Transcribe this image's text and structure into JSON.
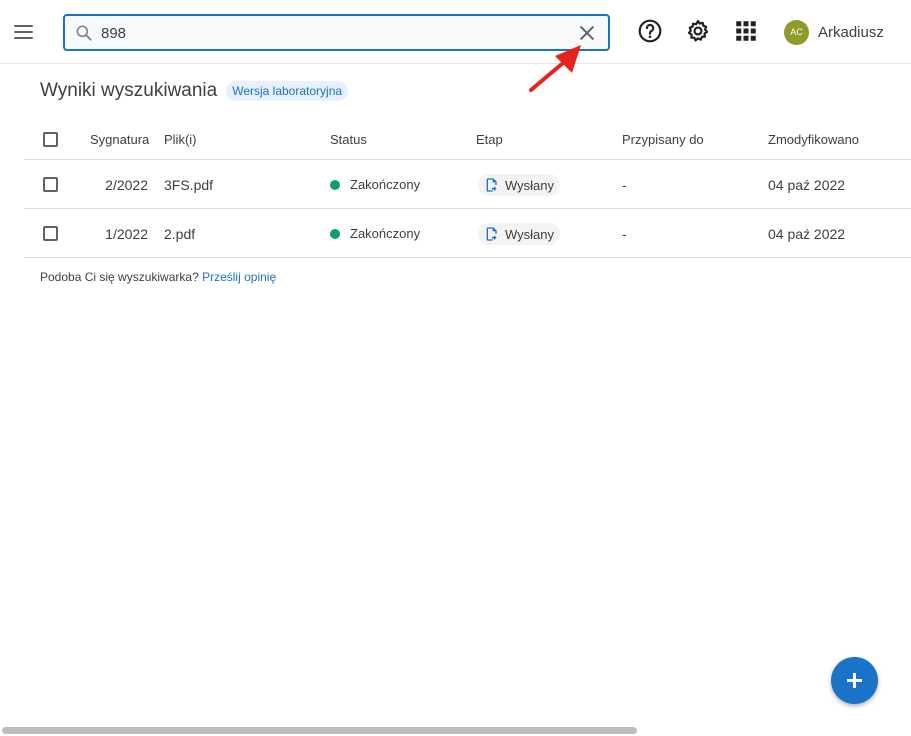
{
  "topbar": {
    "search": {
      "value": "898",
      "placeholder": ""
    },
    "user": {
      "initials": "AC",
      "name": "Arkadiusz"
    },
    "icons": [
      "menu-icon",
      "search-icon",
      "close-icon",
      "help-icon",
      "gear-icon",
      "apps-grid-icon"
    ],
    "accent": "#1a73c8"
  },
  "page": {
    "title": "Wyniki wyszukiwania",
    "badge": "Wersja laboratoryjna"
  },
  "table": {
    "headers": {
      "signature": "Sygnatura",
      "files": "Plik(i)",
      "status": "Status",
      "stage": "Etap",
      "assigned": "Przypisany do",
      "modified": "Zmodyfikowano"
    },
    "rows": [
      {
        "signature": "2/2022",
        "file": "3FS.pdf",
        "status": "Zakończony",
        "stage": "Wysłany",
        "assigned": "-",
        "modified": "04 paź 2022"
      },
      {
        "signature": "1/2022",
        "file": "2.pdf",
        "status": "Zakończony",
        "stage": "Wysłany",
        "assigned": "-",
        "modified": "04 paź 2022"
      }
    ],
    "status_color": "#0f9d74"
  },
  "feedback": {
    "text": "Podoba Ci się wyszukiwarka?",
    "link": "Prześlij opinię"
  },
  "annotation_color": "#e8231c"
}
